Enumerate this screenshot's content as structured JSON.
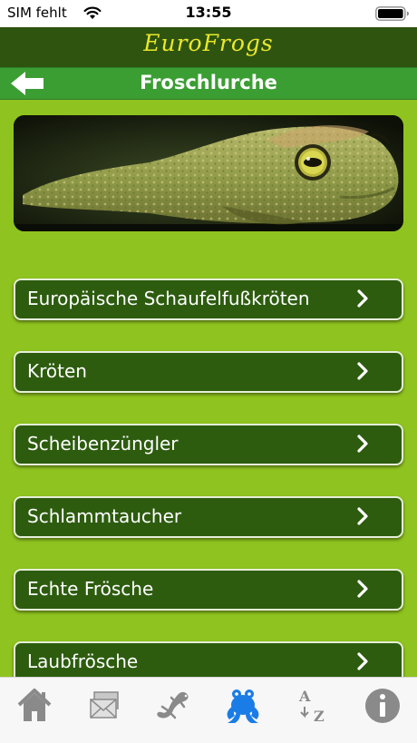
{
  "status_bar": {
    "carrier": "SIM fehlt",
    "time": "13:55",
    "icons": [
      "wifi-icon",
      "battery-icon"
    ]
  },
  "header": {
    "app_title": "EuroFrogs",
    "title_color": "#ebe82a",
    "background": "#2e5410"
  },
  "nav": {
    "title": "Froschlurche",
    "back_icon": "arrow-left-icon",
    "background": "#3b9e33"
  },
  "hero": {
    "subject": "frog-photo"
  },
  "categories": [
    {
      "label": "Europäische Schaufelfußkröten"
    },
    {
      "label": "Kröten"
    },
    {
      "label": "Scheibenzüngler"
    },
    {
      "label": "Schlammtaucher"
    },
    {
      "label": "Echte Frösche"
    },
    {
      "label": "Laubfrösche"
    }
  ],
  "tabbar": {
    "tabs": [
      {
        "icon": "home-icon",
        "active": false
      },
      {
        "icon": "cards-icon",
        "active": false
      },
      {
        "icon": "salamander-icon",
        "active": false
      },
      {
        "icon": "frog-icon",
        "active": true
      },
      {
        "icon": "sort-az-icon",
        "active": false
      },
      {
        "icon": "info-icon",
        "active": false
      }
    ],
    "active_color": "#1a7ce6",
    "inactive_color": "#8a8a8a"
  },
  "colors": {
    "page_background": "#8fc31f",
    "list_item_background": "#2d5c0f",
    "list_item_border": "#e6eed8"
  }
}
